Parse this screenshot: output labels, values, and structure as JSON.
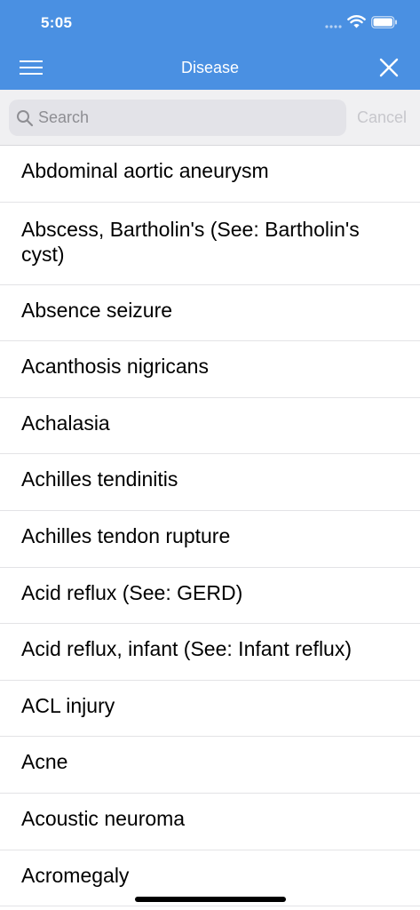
{
  "status_bar": {
    "time": "5:05",
    "icons": [
      "signal-icon",
      "wifi-icon",
      "battery-icon"
    ]
  },
  "nav": {
    "title": "Disease",
    "menu_icon": "hamburger-menu-icon",
    "close_icon": "close-icon"
  },
  "search": {
    "placeholder": "Search",
    "value": "",
    "cancel_label": "Cancel",
    "icon": "search-icon"
  },
  "diseases": [
    "Abdominal aortic aneurysm",
    "Abscess, Bartholin's (See: Bartholin's cyst)",
    "Absence seizure",
    "Acanthosis nigricans",
    "Achalasia",
    "Achilles tendinitis",
    "Achilles tendon rupture",
    "Acid reflux (See: GERD)",
    "Acid reflux, infant (See: Infant reflux)",
    "ACL injury",
    "Acne",
    "Acoustic neuroma",
    "Acromegaly"
  ],
  "colors": {
    "header": "#4a90e2",
    "search_bar": "#f0f0f2",
    "search_field": "#e3e3e8",
    "cancel_disabled": "#c7c7cc",
    "separator": "#e3e3e6"
  }
}
